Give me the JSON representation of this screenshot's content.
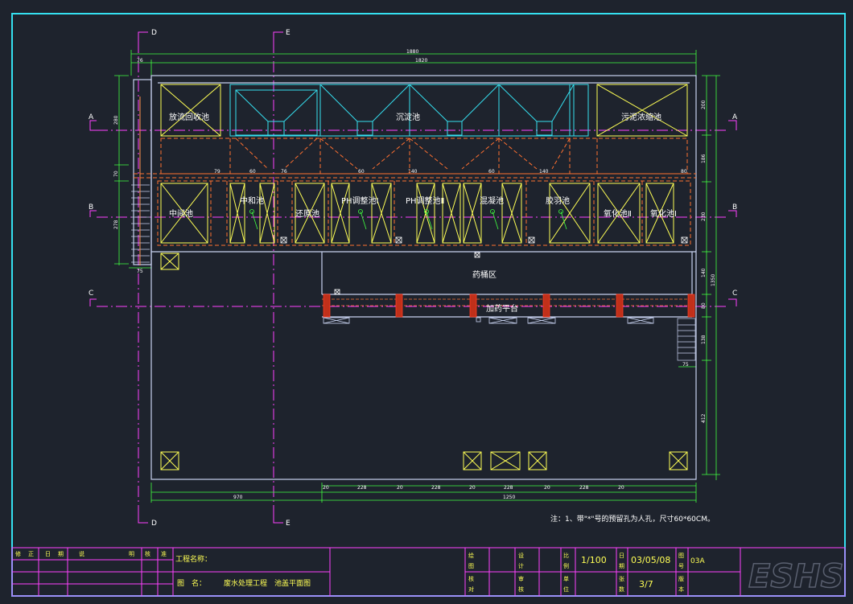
{
  "colors": {
    "frame": "#35e0f0",
    "wall": "#c8d2f0",
    "tank": "#ffff55",
    "green": "#40ff40",
    "magenta": "#ff40ff",
    "orange": "#ff7030",
    "white": "#ffffff",
    "red": "#ff3a20",
    "bg": "#1e232d"
  },
  "grid": {
    "d_top": "D",
    "e_top": "E",
    "d_bot": "D",
    "e_bot": "E",
    "a_left": "A",
    "a_right": "A",
    "b_left": "B",
    "b_right": "B",
    "c_left": "C",
    "c_right": "C"
  },
  "tanks_top": {
    "reflux": "放流回收池",
    "settle": "沉淀池",
    "sludge": "污泥浓缩池"
  },
  "tanks_mid": {
    "middle": "中间池",
    "neutral": "中和池",
    "reduce": "还原池",
    "ph1": "PH调整池Ⅰ",
    "ph2": "PH调整池Ⅱ",
    "coag": "混凝池",
    "floc": "胶羽池",
    "oxid2": "氧化池Ⅱ",
    "oxid1": "氧化池Ⅰ"
  },
  "areas": {
    "chem": "药桶区",
    "platform": "加药平台"
  },
  "dims": {
    "overall": "1880",
    "inner": "1820",
    "left_off": "76",
    "t60a": "60",
    "t76": "76",
    "t60b": "60",
    "t140a": "140",
    "t60c": "60",
    "t140b": "140",
    "t80": "80",
    "t79": "79",
    "r200": "200",
    "r186": "186",
    "r230": "230",
    "r140": "140",
    "r80": "80",
    "r138": "138",
    "r412": "412",
    "r1350": "1350",
    "l280": "280",
    "l70": "70",
    "l278": "278",
    "l75": "75",
    "b970": "970",
    "b1250": "1250",
    "b20a": "20",
    "b228a": "228",
    "b20b": "20",
    "b228b": "228",
    "b20c": "20",
    "b228c": "228",
    "b20d": "20",
    "b228d": "228",
    "b20e": "20",
    "r75": "75"
  },
  "note": "注：1、带\"*\"号的预留孔为人孔，尺寸60*60CM。",
  "title_block": {
    "h_rev": "修",
    "h_zheng": "正",
    "h_date": "日",
    "h_period": "期",
    "h_shuo": "说",
    "h_ming": "明",
    "h_sign": "核",
    "h_approve": "准",
    "project_label": "工程名称：",
    "drawing_label": "图　名：",
    "drawing_name": "废水处理工程　池盖平面图",
    "l_draw": "绘",
    "l_fig": "图",
    "l_check": "核",
    "l_pair": "对",
    "l_design": "设",
    "l_calc": "计",
    "l_review": "审",
    "l_approve": "核",
    "l_scale": "比",
    "l_ratio": "例",
    "l_unit": "单",
    "l_pos": "位",
    "scale": "1/100",
    "l_date": "日",
    "l_qi": "期",
    "l_sheet": "张",
    "l_num": "数",
    "date": "03/05/08",
    "sheet": "3/7",
    "l_tu": "图",
    "l_hao": "号",
    "l_ban": "版",
    "l_ben": "本",
    "drawing_no": "03A"
  },
  "watermark": "ESHS"
}
